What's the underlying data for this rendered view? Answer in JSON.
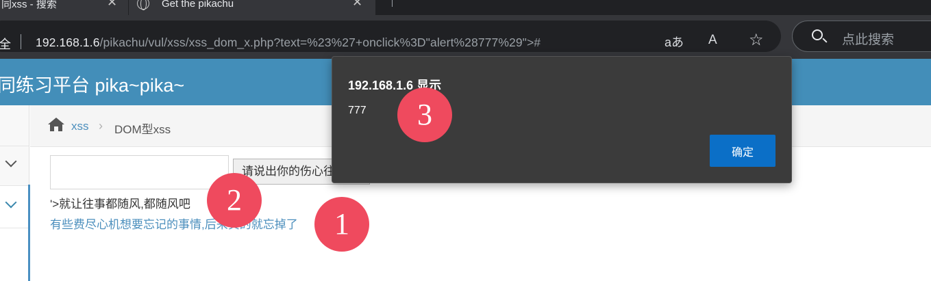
{
  "browser": {
    "tabs": [
      {
        "title": "同xss - 搜索"
      },
      {
        "title": "Get the pikachu"
      }
    ],
    "tab_close_glyph": "✕",
    "security_label": "安全",
    "url": {
      "host": "192.168.1.6",
      "path": "/pikachu/vul/xss/xss_dom_x.php?text=%23%27+onclick%3D\"alert%28777%29\">#"
    },
    "toolbar_icons": [
      "read-aloud-translate-icon",
      "read-aloud-icon",
      "favorite-star-icon"
    ],
    "toolbar_glyphs": {
      "translate": "aあ",
      "read_aloud": "A",
      "favorite": "☆"
    },
    "search_placeholder": "点此搜索"
  },
  "site": {
    "title": "同练习平台 pika~pika~"
  },
  "breadcrumb": {
    "link": "xss",
    "separator": "›",
    "current": "DOM型xss"
  },
  "form": {
    "input_value": "",
    "submit_label": "请说出你的伤心往事"
  },
  "output": {
    "text": "'>就让往事都随风,都随风吧",
    "link": "有些费尽心机想要忘记的事情,后来真的就忘掉了"
  },
  "dialog": {
    "title": "192.168.1.6 显示",
    "message": "777",
    "ok_label": "确定"
  },
  "markers": [
    "1",
    "2",
    "3"
  ],
  "colors": {
    "header": "#438eb9",
    "marker": "#ef4a5e",
    "ok_button": "#0b6fc7",
    "link": "#4c8fbd"
  }
}
